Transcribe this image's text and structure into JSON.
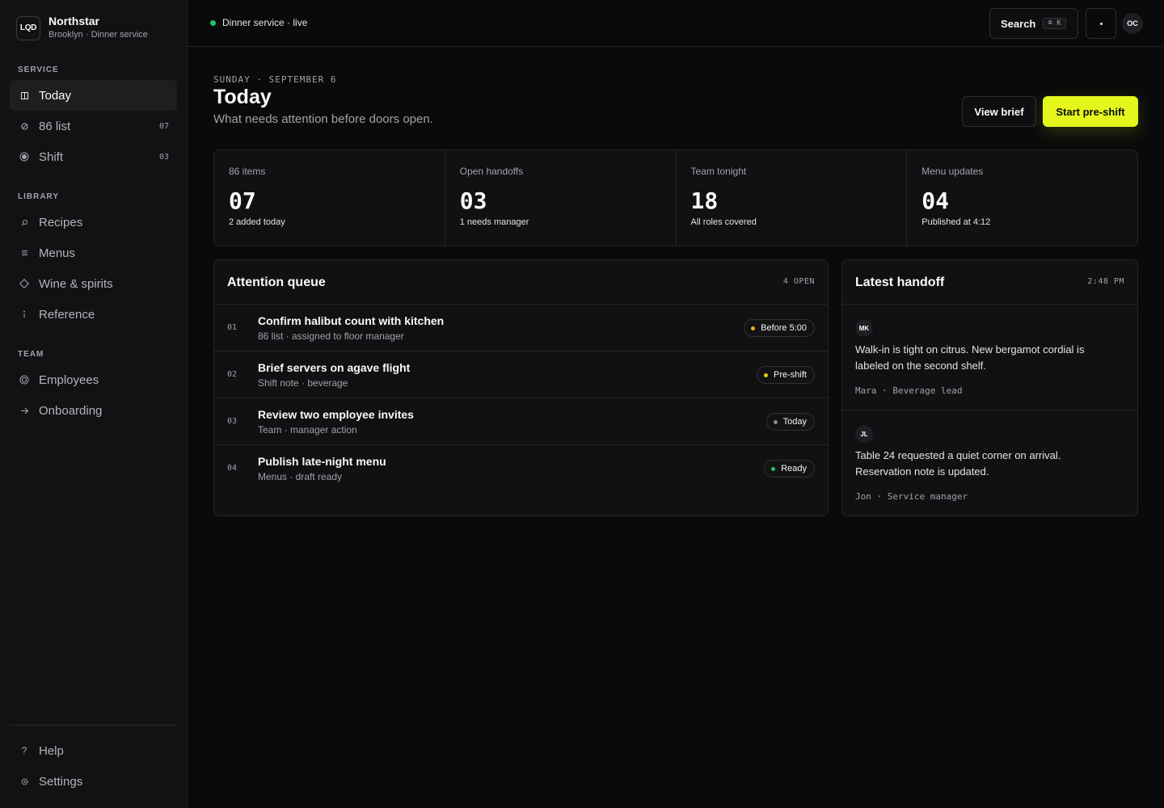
{
  "brand": {
    "logo": "LQD",
    "name": "Northstar",
    "subtitle": "Brooklyn · Dinner service"
  },
  "sidebar": {
    "sections": {
      "service": "SERVICE",
      "library": "LIBRARY",
      "team": "TEAM"
    },
    "items": {
      "today": {
        "label": "Today",
        "icon": "grid-icon"
      },
      "list86": {
        "label": "86 list",
        "count": "07",
        "icon": "ban-icon"
      },
      "shift": {
        "label": "Shift",
        "count": "03",
        "icon": "radio-icon"
      },
      "recipes": {
        "label": "Recipes",
        "icon": "search-icon"
      },
      "menus": {
        "label": "Menus",
        "icon": "lines-icon"
      },
      "wine": {
        "label": "Wine & spirits",
        "icon": "diamond-icon"
      },
      "reference": {
        "label": "Reference",
        "icon": "info-icon"
      },
      "employees": {
        "label": "Employees",
        "icon": "ring-icon"
      },
      "onboarding": {
        "label": "Onboarding",
        "icon": "arrow-right-icon"
      },
      "help": {
        "label": "Help",
        "icon": "question-icon"
      },
      "settings": {
        "label": "Settings",
        "icon": "gear-icon"
      }
    }
  },
  "topbar": {
    "status": "Dinner service · live",
    "status_color": "#22c55e",
    "search_label": "Search",
    "search_shortcut": "⌘ K",
    "more_label": "·",
    "avatar": "OC"
  },
  "header": {
    "date": "SUNDAY · SEPTEMBER 6",
    "title": "Today",
    "subtitle": "What needs attention before doors open.",
    "view_brief": "View brief",
    "start_preshift": "Start pre-shift",
    "accent_color": "#e4f71d"
  },
  "stats": [
    {
      "label": "86 items",
      "value": "07",
      "sub": "2 added today"
    },
    {
      "label": "Open handoffs",
      "value": "03",
      "sub": "1 needs manager"
    },
    {
      "label": "Team tonight",
      "value": "18",
      "sub": "All roles covered"
    },
    {
      "label": "Menu updates",
      "value": "04",
      "sub": "Published at 4:12"
    }
  ],
  "queue": {
    "title": "Attention queue",
    "meta": "4 OPEN",
    "rows": [
      {
        "num": "01",
        "title": "Confirm halibut count with kitchen",
        "sub": "86 list · assigned to floor manager",
        "badge": "Before 5:00",
        "badge_color": "#eab308"
      },
      {
        "num": "02",
        "title": "Brief servers on agave flight",
        "sub": "Shift note · beverage",
        "badge": "Pre-shift",
        "badge_color": "#e4d00a"
      },
      {
        "num": "03",
        "title": "Review two employee invites",
        "sub": "Team · manager action",
        "badge": "Today",
        "badge_color": "#8a8a92"
      },
      {
        "num": "04",
        "title": "Publish late-night menu",
        "sub": "Menus · draft ready",
        "badge": "Ready",
        "badge_color": "#22c55e"
      }
    ]
  },
  "handoff": {
    "title": "Latest handoff",
    "time": "2:48 PM",
    "notes": [
      {
        "initials": "MK",
        "text": "Walk-in is tight on citrus. New bergamot cordial is labeled on the second shelf.",
        "author": "Mara · Beverage lead"
      },
      {
        "initials": "JL",
        "text": "Table 24 requested a quiet corner on arrival. Reservation note is updated.",
        "author": "Jon · Service manager"
      }
    ]
  }
}
